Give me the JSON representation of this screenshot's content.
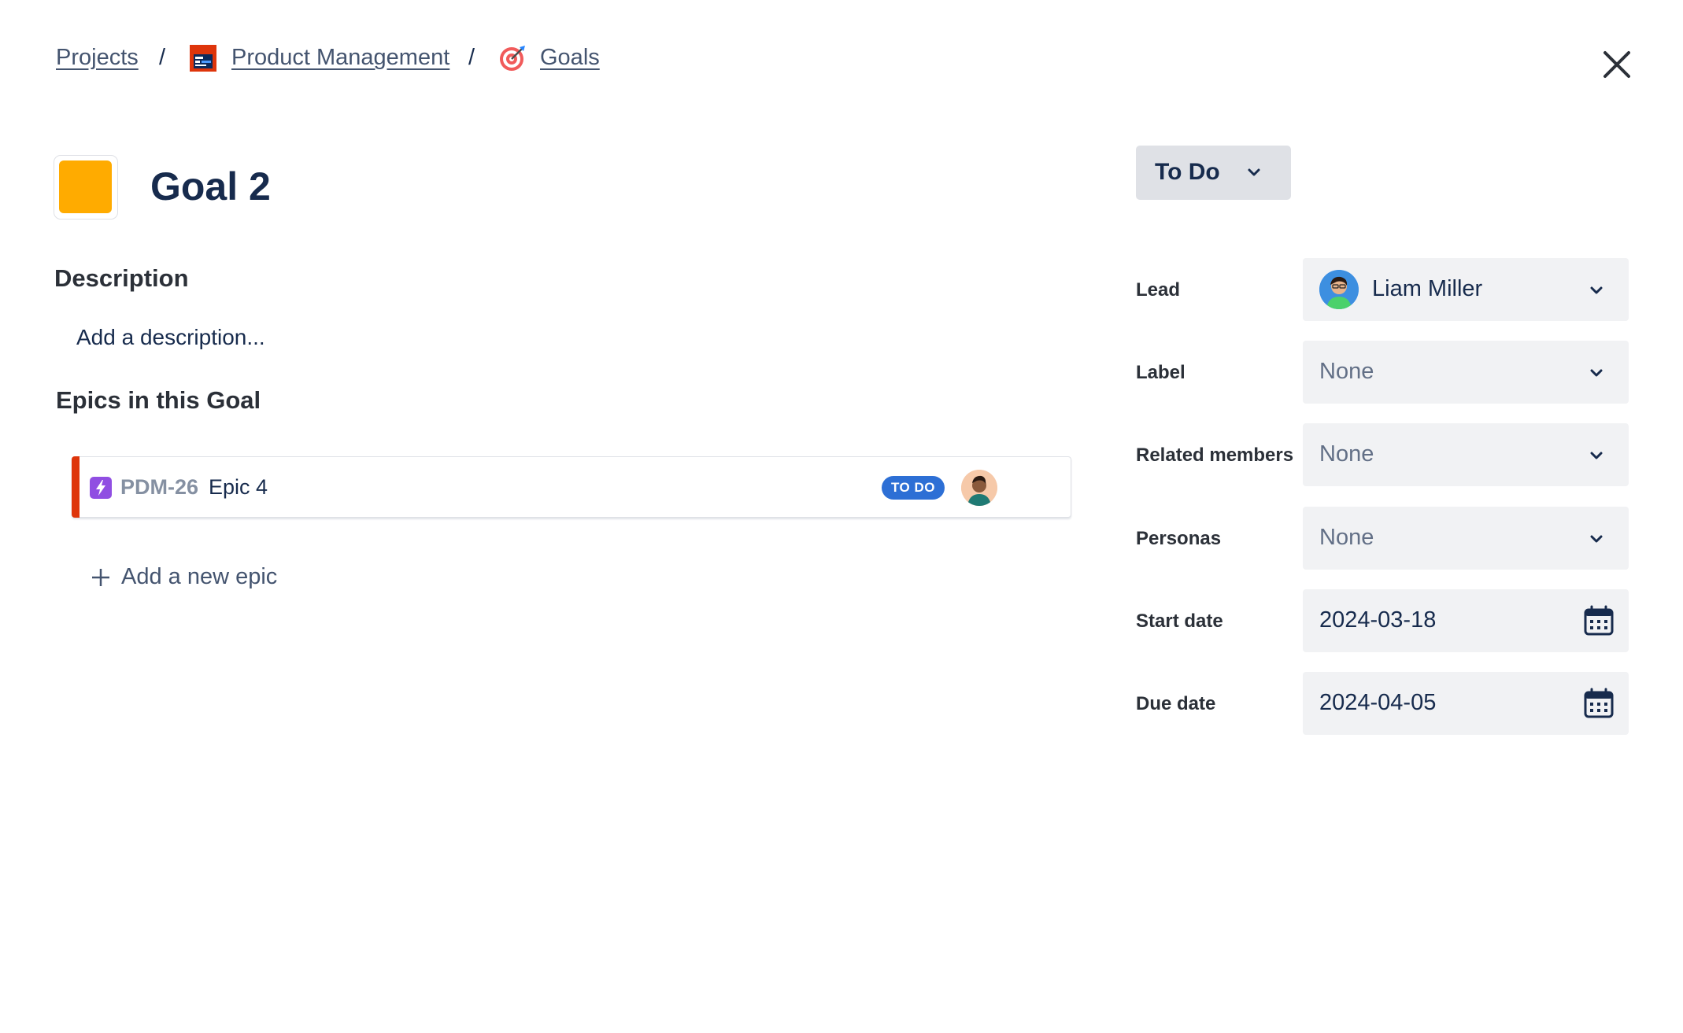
{
  "breadcrumb": {
    "projects": "Projects",
    "separator": "/",
    "project_name": "Product Management",
    "section": "Goals"
  },
  "icons": {
    "close": "close-icon",
    "project": "project-board-icon",
    "goals": "target-icon",
    "epic": "lightning-icon",
    "chevron": "chevron-down-icon",
    "calendar": "calendar-icon",
    "plus": "plus-icon"
  },
  "goal": {
    "title": "Goal 2",
    "color": "#FFAB00"
  },
  "description": {
    "heading": "Description",
    "placeholder": "Add a description..."
  },
  "epics": {
    "heading": "Epics in this Goal",
    "items": [
      {
        "key": "PDM-26",
        "name": "Epic 4",
        "status": "TO DO",
        "accent_color": "#DE350B"
      }
    ],
    "add_label": "Add a new epic"
  },
  "status": {
    "label": "To Do"
  },
  "fields": {
    "lead": {
      "label": "Lead",
      "value": "Liam Miller"
    },
    "label": {
      "label": "Label",
      "value": "None"
    },
    "related_members": {
      "label": "Related members",
      "value": "None"
    },
    "personas": {
      "label": "Personas",
      "value": "None"
    },
    "start_date": {
      "label": "Start date",
      "value": "2024-03-18"
    },
    "due_date": {
      "label": "Due date",
      "value": "2024-04-05"
    }
  }
}
